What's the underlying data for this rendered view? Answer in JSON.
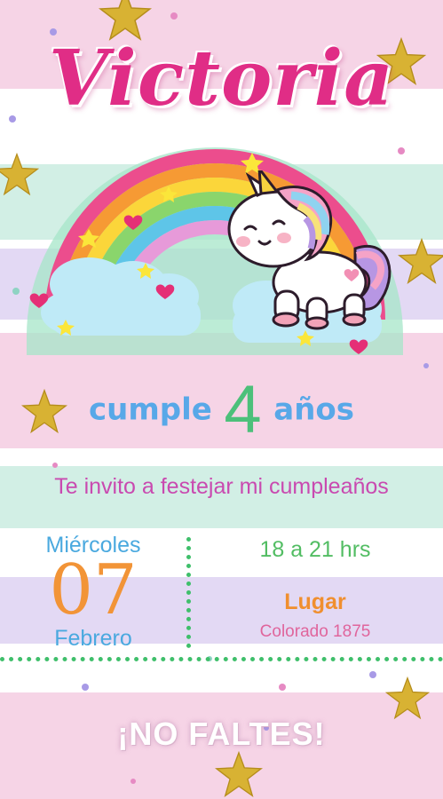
{
  "invitation": {
    "child_name": "Victoria",
    "age_prefix": "cumple",
    "age_number": "4",
    "age_suffix": "años",
    "invite_text": "Te invito a festejar mi cumpleaños",
    "weekday": "Miércoles",
    "day": "07",
    "month": "Febrero",
    "time": "18 a 21 hrs",
    "place_label": "Lugar",
    "place_value": "Colorado 1875",
    "closing": "¡NO FALTES!"
  },
  "colors": {
    "name": "#e02d86",
    "age_text": "#58a8e8",
    "age_number": "#4cc07a",
    "invite_text": "#c94ab0",
    "date_text": "#4aa9df",
    "day_number": "#f29437",
    "time": "#52bd63",
    "place_label": "#f08f2f",
    "place_value": "#e0659c",
    "dotted_separator": "#3fbf6b",
    "stripe_pink": "#f6d4e6",
    "stripe_mint": "#d2efe5",
    "stripe_lavender": "#e3d9f4"
  },
  "decorations": {
    "icons": [
      "rainbow-illustration",
      "unicorn-illustration",
      "cloud-icon",
      "gold-star-icon",
      "heart-icon"
    ]
  }
}
